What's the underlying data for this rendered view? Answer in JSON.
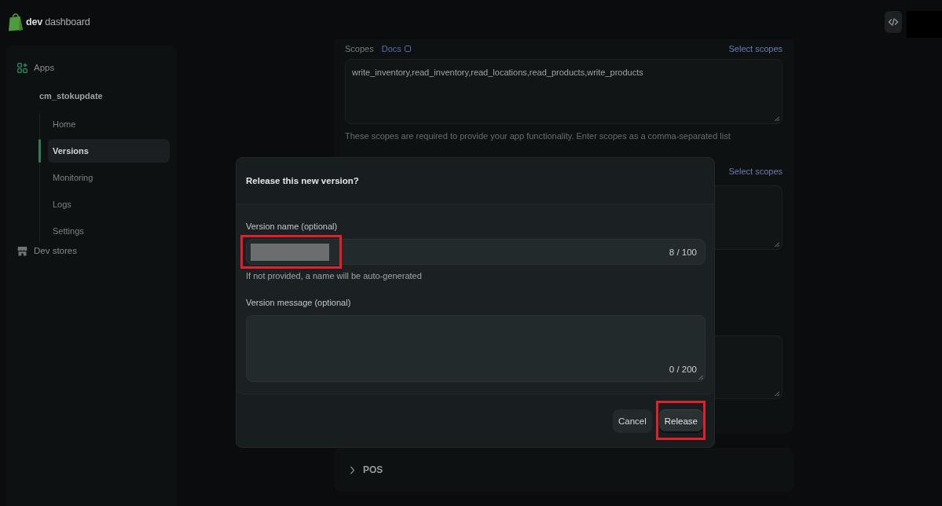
{
  "top_bar": {
    "brand": "**dev** dashboard"
  },
  "sidebar": {
    "items": [
      {
        "label": "Apps",
        "active": true,
        "children": [
          {
            "label": "cm_stokupdate",
            "children": [
              {
                "label": "Home",
                "selected": false
              },
              {
                "label": "Versions",
                "selected": true
              },
              {
                "label": "Monitoring",
                "selected": false
              },
              {
                "label": "Logs",
                "selected": false
              },
              {
                "label": "Settings",
                "selected": false
              }
            ]
          }
        ]
      },
      {
        "label": "Dev stores",
        "active": false
      }
    ]
  },
  "app_config": {
    "sections": [
      {
        "label": "Scopes",
        "link": "Docs",
        "action": "Select scopes",
        "value": "write_inventory,read_inventory,read_locations,read_products,write_products",
        "help": "These scopes are required to provide your app functionality. Enter scopes as a comma-separated list"
      },
      {
        "action": "Select scopes"
      }
    ]
  },
  "pos_panel": {
    "title": "POS",
    "expanded": false
  },
  "dialog": {
    "title": "Release this new version?",
    "fields": [
      {
        "kind": "input",
        "label": "Version name (optional)",
        "redacted": true,
        "counter": "8 / 100",
        "help": "If not provided, a name will be auto-generated",
        "highlighted": true
      },
      {
        "kind": "textarea",
        "label": "Version message (optional)",
        "counter": "0 / 200",
        "highlighted": false
      }
    ],
    "buttons": [
      {
        "label": "Cancel",
        "kind": "secondary",
        "highlighted": false
      },
      {
        "label": "Release",
        "kind": "primary",
        "highlighted": true
      }
    ]
  }
}
